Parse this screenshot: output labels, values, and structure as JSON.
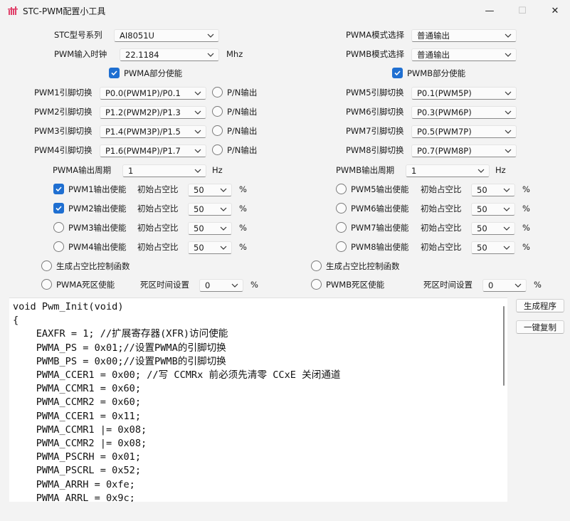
{
  "window": {
    "title": "STC-PWM配置小工具",
    "minimize": "—",
    "maximize": "☐",
    "close": "✕"
  },
  "top": {
    "model_label": "STC型号系列",
    "model_value": "AI8051U",
    "clock_label": "PWM输入时钟",
    "clock_value": "22.1184",
    "clock_unit": "Mhz",
    "pwma_mode_label": "PWMA模式选择",
    "pwma_mode_value": "普通输出",
    "pwmb_mode_label": "PWMB模式选择",
    "pwmb_mode_value": "普通输出",
    "pwma_enable_label": "PWMA部分使能",
    "pwma_enable": true,
    "pwmb_enable_label": "PWMB部分使能",
    "pwmb_enable": true
  },
  "pins": {
    "pn_label": "P/N输出",
    "left": [
      {
        "label": "PWM1引脚切换",
        "value": "P0.0(PWM1P)/P0.1"
      },
      {
        "label": "PWM2引脚切换",
        "value": "P1.2(PWM2P)/P1.3"
      },
      {
        "label": "PWM3引脚切换",
        "value": "P1.4(PWM3P)/P1.5"
      },
      {
        "label": "PWM4引脚切换",
        "value": "P1.6(PWM4P)/P1.7"
      }
    ],
    "right": [
      {
        "label": "PWM5引脚切换",
        "value": "P0.1(PWM5P)"
      },
      {
        "label": "PWM6引脚切换",
        "value": "P0.3(PWM6P)"
      },
      {
        "label": "PWM7引脚切换",
        "value": "P0.5(PWM7P)"
      },
      {
        "label": "PWM8引脚切换",
        "value": "P0.7(PWM8P)"
      }
    ]
  },
  "period": {
    "pwma_label": "PWMA输出周期",
    "pwma_value": "1",
    "pwmb_label": "PWMB输出周期",
    "pwmb_value": "1",
    "unit": "Hz"
  },
  "channels": {
    "duty_label": "初始占空比",
    "pct": "%",
    "left": [
      {
        "label": "PWM1输出使能",
        "checked": true,
        "duty": "50"
      },
      {
        "label": "PWM2输出使能",
        "checked": true,
        "duty": "50"
      },
      {
        "label": "PWM3输出使能",
        "checked": false,
        "duty": "50"
      },
      {
        "label": "PWM4输出使能",
        "checked": false,
        "duty": "50"
      }
    ],
    "right": [
      {
        "label": "PWM5输出使能",
        "checked": false,
        "duty": "50"
      },
      {
        "label": "PWM6输出使能",
        "checked": false,
        "duty": "50"
      },
      {
        "label": "PWM7输出使能",
        "checked": false,
        "duty": "50"
      },
      {
        "label": "PWM8输出使能",
        "checked": false,
        "duty": "50"
      }
    ]
  },
  "extra": {
    "gen_duty_label": "生成占空比控制函数",
    "pwma_dead_label": "PWMA死区使能",
    "pwmb_dead_label": "PWMB死区使能",
    "dead_time_label": "死区时间设置",
    "dead_time_a": "0",
    "dead_time_b": "0",
    "pct": "%"
  },
  "buttons": {
    "generate": "生成程序",
    "copy": "一键复制"
  },
  "code": {
    "text": "void Pwm_Init(void)\n{\n    EAXFR = 1; //扩展寄存器(XFR)访问使能\n    PWMA_PS = 0x01;//设置PWMA的引脚切换\n    PWMB_PS = 0x00;//设置PWMB的引脚切换\n    PWMA_CCER1 = 0x00; //写 CCMRx 前必须先清零 CCxE 关闭通道\n    PWMA_CCMR1 = 0x60;\n    PWMA_CCMR2 = 0x60;\n    PWMA_CCER1 = 0x11;\n    PWMA_CCMR1 |= 0x08;\n    PWMA_CCMR2 |= 0x08;\n    PWMA_PSCRH = 0x01;\n    PWMA_PSCRL = 0x52;\n    PWMA_ARRH = 0xfe;\n    PWMA_ARRL = 0x9c;"
  }
}
